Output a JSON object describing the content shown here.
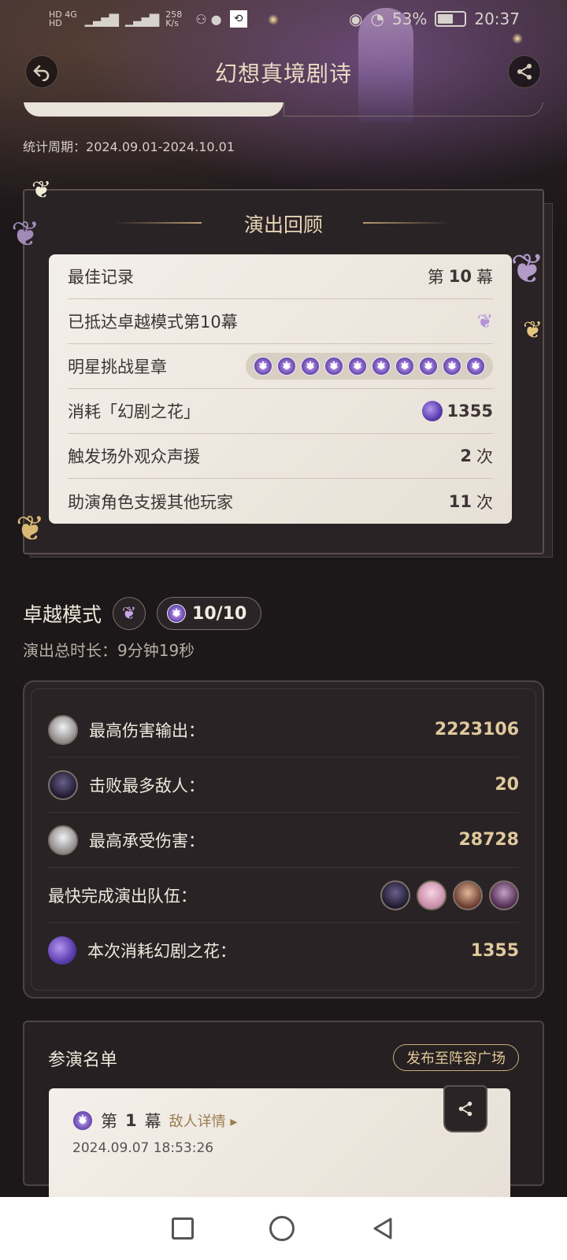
{
  "status_bar": {
    "network_top": "HD 4G",
    "network_bottom": "HD",
    "speed": "258 K/s",
    "battery": "53%",
    "time": "20:37"
  },
  "header": {
    "title": "幻想真境剧诗"
  },
  "stats_period": {
    "label": "统计周期：",
    "value": "2024.09.01-2024.10.01"
  },
  "review": {
    "title": "演出回顾",
    "rows": [
      {
        "label": "最佳记录",
        "value_prefix": "第",
        "value": "10",
        "value_suffix": "幕"
      },
      {
        "label": "已抵达卓越模式第10幕"
      },
      {
        "label": "明星挑战星章",
        "stars": 10
      },
      {
        "label": "消耗「幻剧之花」",
        "value": "1355"
      },
      {
        "label": "触发场外观众声援",
        "value": "2",
        "value_suffix": "次"
      },
      {
        "label": "助演角色支援其他玩家",
        "value": "11",
        "value_suffix": "次"
      }
    ]
  },
  "mode": {
    "title": "卓越模式",
    "score": "10/10",
    "duration": "演出总时长：9分钟19秒"
  },
  "stats": [
    {
      "label": "最高伤害输出：",
      "value": "2223106"
    },
    {
      "label": "击败最多敌人：",
      "value": "20"
    },
    {
      "label": "最高承受伤害：",
      "value": "28728"
    },
    {
      "label": "最快完成演出队伍："
    },
    {
      "label": "本次消耗幻剧之花：",
      "value": "1355"
    }
  ],
  "cast": {
    "title": "参演名单",
    "publish_button": "发布至阵容广场",
    "act": {
      "prefix": "第",
      "number": "1",
      "suffix": "幕",
      "enemy_link": "敌人详情",
      "time": "2024.09.07 18:53:26"
    }
  },
  "colors": {
    "background": "#1c1719",
    "gold": "#e0c99c",
    "card": "#f3efe9"
  }
}
